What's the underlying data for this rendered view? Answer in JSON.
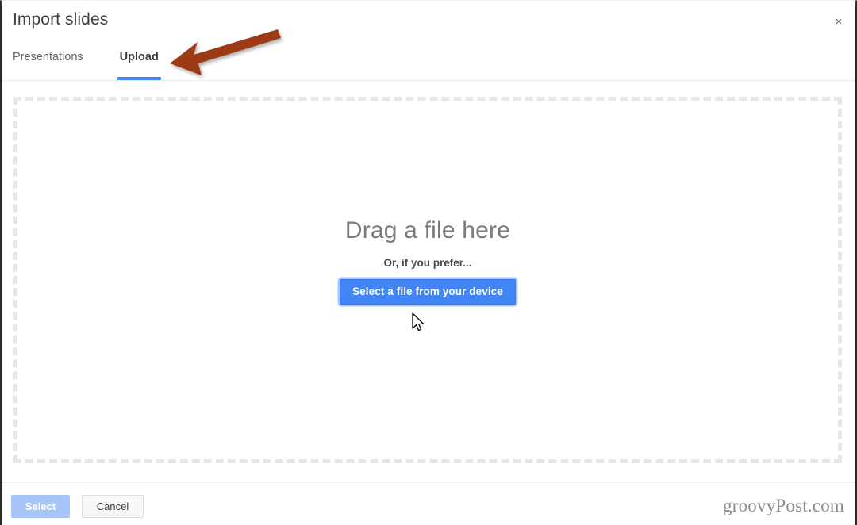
{
  "dialog": {
    "title": "Import slides",
    "close_label": "×"
  },
  "tabs": [
    {
      "label": "Presentations",
      "active": false
    },
    {
      "label": "Upload",
      "active": true
    }
  ],
  "drop_zone": {
    "drag_title": "Drag a file here",
    "or_text": "Or, if you prefer...",
    "select_device_label": "Select a file from your device"
  },
  "footer": {
    "select_label": "Select",
    "cancel_label": "Cancel",
    "watermark": "groovyPost.com"
  },
  "annotation": {
    "arrow_color": "#9c3a12",
    "arrow_target": "upload-tab"
  },
  "colors": {
    "accent_blue": "#4285f4",
    "tab_underline": "#4285f4",
    "disabled_blue": "#a6c5f8",
    "dashed_border": "#e6e6e6",
    "title_gray": "#3c4043",
    "muted_gray": "#5f6368",
    "drag_text_gray": "#7a7a7a",
    "watermark_gray": "#8d8d8d",
    "focus_ring": "#a8c7fa"
  }
}
